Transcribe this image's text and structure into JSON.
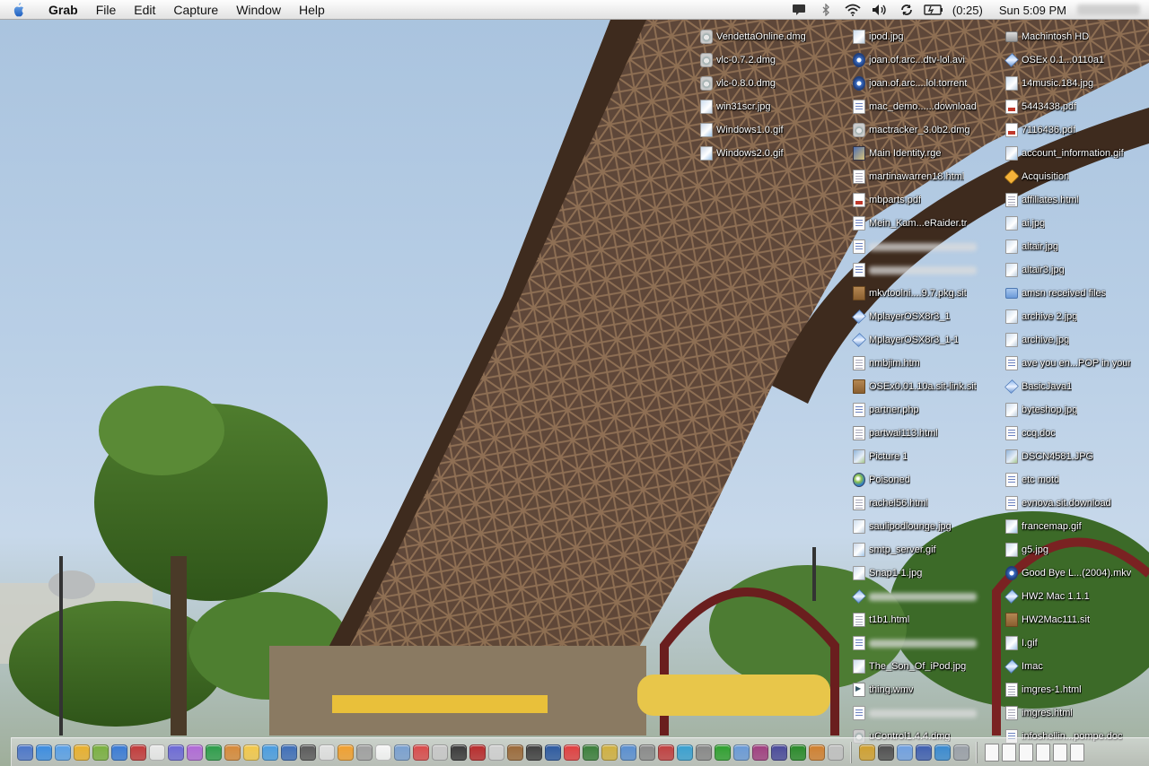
{
  "menubar": {
    "app_name": "Grab",
    "menus": [
      "File",
      "Edit",
      "Capture",
      "Window",
      "Help"
    ],
    "battery": "(0:25)",
    "clock": "Sun 5:09 PM"
  },
  "desktop": {
    "columns": [
      [
        {
          "name": "VendettaOnline.dmg",
          "kind": "dmg"
        },
        {
          "name": "vlc-0.7.2.dmg",
          "kind": "dmg"
        },
        {
          "name": "vlc-0.8.0.dmg",
          "kind": "dmg"
        },
        {
          "name": "win31scr.jpg",
          "kind": "jpgfile"
        },
        {
          "name": "Windows1.0.gif",
          "kind": "gif"
        },
        {
          "name": "Windows2.0.gif",
          "kind": "gif"
        }
      ],
      [
        {
          "name": "ipod.jpg",
          "kind": "jpgfile"
        },
        {
          "name": "joan.of.arc...dtv-lol.avi",
          "kind": "torrent"
        },
        {
          "name": "joan.of.arc....lol.torrent",
          "kind": "torrent"
        },
        {
          "name": "mac_demo......download",
          "kind": "doc"
        },
        {
          "name": "mactracker_3.0b2.dmg",
          "kind": "dmg"
        },
        {
          "name": "Main Identity.rge",
          "kind": "rge"
        },
        {
          "name": "martinawarren18.html",
          "kind": "html"
        },
        {
          "name": "mbparts.pdf",
          "kind": "pdf"
        },
        {
          "name": "Mein_Kam...eRaider.tr",
          "kind": "doc"
        },
        {
          "name": "",
          "kind": "doc",
          "blurred": true
        },
        {
          "name": "",
          "kind": "doc",
          "blurred": true
        },
        {
          "name": "mkvtoolni....9.7.pkg.sit",
          "kind": "sit"
        },
        {
          "name": "MplayerOSX8r3_1",
          "kind": "gem"
        },
        {
          "name": "MplayerOSX8r3_1-1",
          "kind": "gem"
        },
        {
          "name": "nmbjim.htm",
          "kind": "html"
        },
        {
          "name": "OSEx0.01.10a.sit-link.sit",
          "kind": "sit"
        },
        {
          "name": "partner.php",
          "kind": "doc"
        },
        {
          "name": "partwai113.html",
          "kind": "html"
        },
        {
          "name": "Picture 1",
          "kind": "img"
        },
        {
          "name": "Poisoned",
          "kind": "app"
        },
        {
          "name": "rachel56.html",
          "kind": "html"
        },
        {
          "name": "saulipodlounge.jpg",
          "kind": "jpgfile"
        },
        {
          "name": "smtp_server.gif",
          "kind": "gif"
        },
        {
          "name": "Snap1-1.jpg",
          "kind": "jpgfile"
        },
        {
          "name": "",
          "kind": "gem",
          "blurred": true
        },
        {
          "name": "t1b1.html",
          "kind": "html"
        },
        {
          "name": "",
          "kind": "doc",
          "blurred": true
        },
        {
          "name": "The_Son_Of_iPod.jpg",
          "kind": "jpgfile"
        },
        {
          "name": "thing.wmv",
          "kind": "wmv"
        },
        {
          "name": "",
          "kind": "doc",
          "blurred": true
        },
        {
          "name": "uControl1.4.4.dmg",
          "kind": "dmg"
        }
      ],
      [
        {
          "name": "Machintosh HD",
          "kind": "hd"
        },
        {
          "name": "OSEx 0.1...0110a1",
          "kind": "gem"
        },
        {
          "name": "14music.184.jpg",
          "kind": "jpgfile"
        },
        {
          "name": "5443438.pdf",
          "kind": "pdf"
        },
        {
          "name": "7116436.pdf",
          "kind": "pdf"
        },
        {
          "name": "account_information.gif",
          "kind": "gif"
        },
        {
          "name": "Acquisition",
          "kind": "alert"
        },
        {
          "name": "affiliates.html",
          "kind": "html"
        },
        {
          "name": "ai.jpg",
          "kind": "jpgfile"
        },
        {
          "name": "altair.jpg",
          "kind": "jpgfile"
        },
        {
          "name": "altair3.jpg",
          "kind": "jpgfile"
        },
        {
          "name": "amsn received files",
          "kind": "folder"
        },
        {
          "name": "archive 2.jpg",
          "kind": "jpgfile"
        },
        {
          "name": "archive.jpg",
          "kind": "jpgfile"
        },
        {
          "name": "ave you en...POP in your",
          "kind": "doc"
        },
        {
          "name": "BasicJava1",
          "kind": "gem"
        },
        {
          "name": "byteshop.jpg",
          "kind": "jpgfile"
        },
        {
          "name": "ccq.doc",
          "kind": "doc"
        },
        {
          "name": "DSCN4581.JPG",
          "kind": "img"
        },
        {
          "name": "etc motd",
          "kind": "doc"
        },
        {
          "name": "evnova.sit.download",
          "kind": "doc"
        },
        {
          "name": "francemap.gif",
          "kind": "gif"
        },
        {
          "name": "g5.jpg",
          "kind": "jpgfile"
        },
        {
          "name": "Good Bye L...(2004).mkv",
          "kind": "torrent"
        },
        {
          "name": "HW2 Mac 1.1.1",
          "kind": "gem"
        },
        {
          "name": "HW2Mac111.sit",
          "kind": "sit"
        },
        {
          "name": "I.gif",
          "kind": "gif"
        },
        {
          "name": "Imac",
          "kind": "gem"
        },
        {
          "name": "imgres-1.html",
          "kind": "html"
        },
        {
          "name": "imgres.html",
          "kind": "html"
        },
        {
          "name": "infoshellin...pompe.doc",
          "kind": "doc"
        }
      ]
    ]
  },
  "dock": {
    "icon_colors": [
      "#4d77c9",
      "#3d8de0",
      "#5aa0e6",
      "#e8b02e",
      "#7ab040",
      "#3a7bd5",
      "#c23b3b",
      "#e8e8e8",
      "#6d6ad6",
      "#b06ad6",
      "#2e9d4a",
      "#d68a3a",
      "#f2c84b",
      "#4a9de0",
      "#3f6fb8",
      "#5b5b5b",
      "#e0e0e0",
      "#f0a030",
      "#a0a0a0",
      "#f5f5f5",
      "#7aa0d0",
      "#d94c4c",
      "#c8c8c8",
      "#3a3a3a",
      "#b82c2c",
      "#d0d0d0",
      "#9b6a3a",
      "#404040",
      "#2d5aa0",
      "#e04040",
      "#3b7f3b",
      "#d0b040",
      "#5a8fd0",
      "#8a8a8a",
      "#c04040",
      "#3aa0d0",
      "#888888",
      "#30a030",
      "#6a9ad6",
      "#a04080",
      "#4a4a9a",
      "#2a8a2a",
      "#d08030",
      "#c0c0c0",
      "#d0a030",
      "#505050",
      "#70a0e0",
      "#4060b0",
      "#3a8ad0",
      "#9aa0a8"
    ],
    "doc_count": 6
  }
}
